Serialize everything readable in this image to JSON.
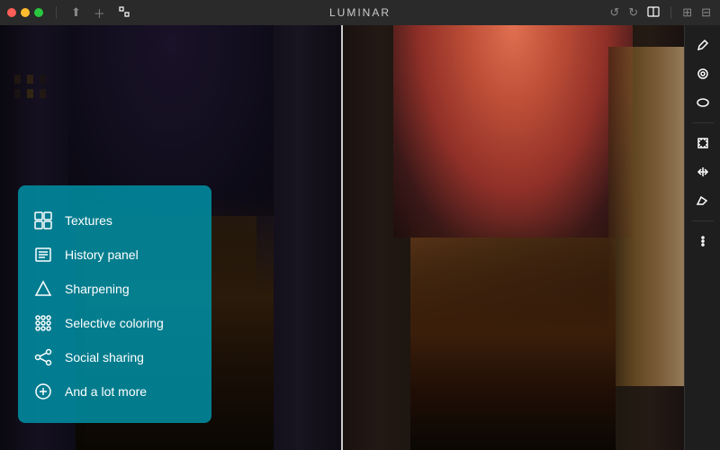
{
  "app": {
    "title": "LUMINAR",
    "window_controls": {
      "close": "close",
      "minimize": "minimize",
      "maximize": "maximize"
    }
  },
  "toolbar": {
    "left_icons": [
      "share-icon",
      "add-icon",
      "crop-icon"
    ],
    "center_title": "LUMINAR",
    "right_icons": [
      "undo-icon",
      "redo-icon",
      "split-icon"
    ],
    "far_right": [
      "fullscreen-icon",
      "panels-icon"
    ]
  },
  "right_sidebar": {
    "icons": [
      {
        "name": "brush-icon",
        "label": "Brush",
        "active": true
      },
      {
        "name": "filter-icon",
        "label": "Filter",
        "active": false
      },
      {
        "name": "circle-icon",
        "label": "Radial",
        "active": false
      },
      {
        "name": "resize-icon",
        "label": "Resize",
        "active": false
      },
      {
        "name": "transform-icon",
        "label": "Transform",
        "active": false
      },
      {
        "name": "eraser-icon",
        "label": "Eraser",
        "active": false
      },
      {
        "name": "more-icon",
        "label": "More",
        "active": false
      }
    ]
  },
  "feature_panel": {
    "items": [
      {
        "id": "textures",
        "label": "Textures",
        "icon": "texture-icon"
      },
      {
        "id": "history-panel",
        "label": "History panel",
        "icon": "history-icon"
      },
      {
        "id": "sharpening",
        "label": "Sharpening",
        "icon": "sharpening-icon"
      },
      {
        "id": "selective-coloring",
        "label": "Selective coloring",
        "icon": "selective-coloring-icon"
      },
      {
        "id": "social-sharing",
        "label": "Social sharing",
        "icon": "social-sharing-icon"
      },
      {
        "id": "and-lot-more",
        "label": "And a lot more",
        "icon": "more-features-icon"
      }
    ]
  }
}
